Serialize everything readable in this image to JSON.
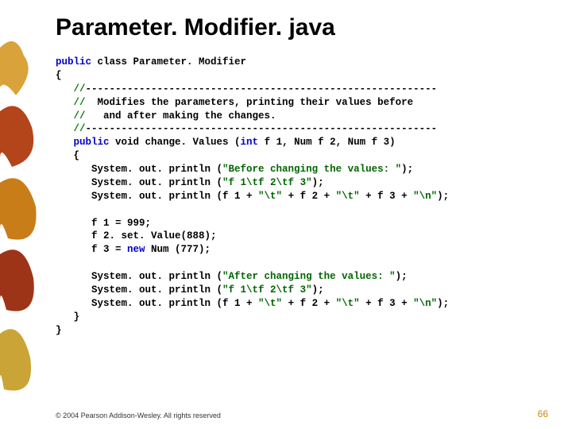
{
  "title": "Parameter. Modifier. java",
  "code": {
    "l01a": "public",
    "l01b": " class ",
    "l01c": "Parameter. Modifier",
    "l02": "{",
    "l03a": "   //",
    "l03b": "-----------------------------------------------------------",
    "l04a": "   //",
    "l04b": "  Modifies the parameters, printing their values before",
    "l05a": "   //",
    "l05b": "   and after making the changes.",
    "l06a": "   //",
    "l06b": "-----------------------------------------------------------",
    "l07a": "   public",
    "l07b": " void change. Values (",
    "l07c": "int",
    "l07d": " f 1, Num f 2, Num f 3)",
    "l08": "   {",
    "l09a": "      System. out. println (",
    "l09b": "\"Before changing the values: \"",
    "l09c": ");",
    "l10a": "      System. out. println (",
    "l10b": "\"f 1\\tf 2\\tf 3\"",
    "l10c": ");",
    "l11a": "      System. out. println (f 1 + ",
    "l11b": "\"\\t\"",
    "l11c": " + f 2 + ",
    "l11d": "\"\\t\"",
    "l11e": " + f 3 + ",
    "l11f": "\"\\n\"",
    "l11g": ");",
    "l13": "      f 1 = 999;",
    "l14": "      f 2. set. Value(888);",
    "l15a": "      f 3 = ",
    "l15b": "new",
    "l15c": " Num (777);",
    "l17a": "      System. out. println (",
    "l17b": "\"After changing the values: \"",
    "l17c": ");",
    "l18a": "      System. out. println (",
    "l18b": "\"f 1\\tf 2\\tf 3\"",
    "l18c": ");",
    "l19a": "      System. out. println (f 1 + ",
    "l19b": "\"\\t\"",
    "l19c": " + f 2 + ",
    "l19d": "\"\\t\"",
    "l19e": " + f 3 + ",
    "l19f": "\"\\n\"",
    "l19g": ");",
    "l20": "   }",
    "l21": "}"
  },
  "footer": {
    "copyright": "© 2004 Pearson Addison-Wesley. All rights reserved",
    "page": "66"
  }
}
